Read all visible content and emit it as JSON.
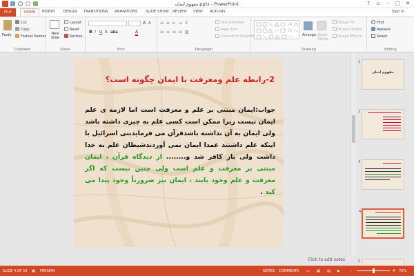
{
  "window": {
    "title": "مفهوم ایمان.pptx - PowerPoint",
    "controls": [
      "?",
      "▫",
      "–",
      "□",
      "✕"
    ]
  },
  "tabs": [
    "FILE",
    "HOME",
    "INSERT",
    "DESIGN",
    "TRANSITIONS",
    "ANIMATIONS",
    "SLIDE SHOW",
    "REVIEW",
    "VIEW",
    "ADD-INS"
  ],
  "sign_in": "Sign in",
  "ribbon": {
    "clipboard": {
      "label": "Clipboard",
      "paste": "Paste",
      "cut": "Cut",
      "copy": "Copy",
      "format_painter": "Format Painter"
    },
    "slides": {
      "label": "Slides",
      "new_slide": "New Slide",
      "layout": "Layout",
      "reset": "Reset",
      "section": "Section"
    },
    "font": {
      "label": "Font"
    },
    "paragraph": {
      "label": "Paragraph",
      "text_direction": "Text Direction",
      "align_text": "Align Text",
      "convert_smartart": "Convert to SmartArt"
    },
    "drawing": {
      "label": "Drawing",
      "arrange": "Arrange",
      "quick_styles": "Quick Styles",
      "shape_fill": "Shape Fill",
      "shape_outline": "Shape Outline",
      "shape_effects": "Shape Effects"
    },
    "editing": {
      "label": "Editing",
      "find": "Find",
      "replace": "Replace",
      "select": "Select"
    }
  },
  "slide": {
    "title": "2-رابطه علم ومعرفت با ایمان چگونه است؟",
    "body_black": "جواب:ایمان مبتنی بر علم و معرفت است اما لازمه ی علم ایمان نیست زیرا ممکن است کسی علم به چیزی داشته باشد ولی ایمان به آن نداشته باشدقرآن می فرمایدبنی اسرائیل با اینکه علم داشتند عمدا ایمان نمی آوردندشیطان علم به خدا داشت ولی باز کافر شد و........ ",
    "body_green": "از دیدگاه قرآن ، ایمان مبتنی بر معرفت و علم است ولی چنین نیست که اگر معرفت و علم وجود یابند ، ایمان نیز ضرورتاً وجود پیدا می کند",
    "body_end": " ."
  },
  "thumbnails": [
    {
      "num": "1",
      "title": "مفهوم ایمان"
    },
    {
      "num": "2",
      "title": ""
    },
    {
      "num": "3",
      "title": ""
    },
    {
      "num": "4",
      "title": ""
    },
    {
      "num": "5",
      "title": ""
    }
  ],
  "notes_placeholder": "Click to add notes",
  "status": {
    "slide_counter": "SLIDE 4 OF 18",
    "language": "PERSIAN",
    "notes": "NOTES",
    "comments": "COMMENTS",
    "zoom_minus": "-",
    "zoom_plus": "+",
    "zoom_value": "70%"
  },
  "colors": {
    "accent": "#d24726",
    "title_red": "#d41e1e",
    "body_green": "#1e9b1e",
    "slide_bg": "#efe1cd"
  }
}
